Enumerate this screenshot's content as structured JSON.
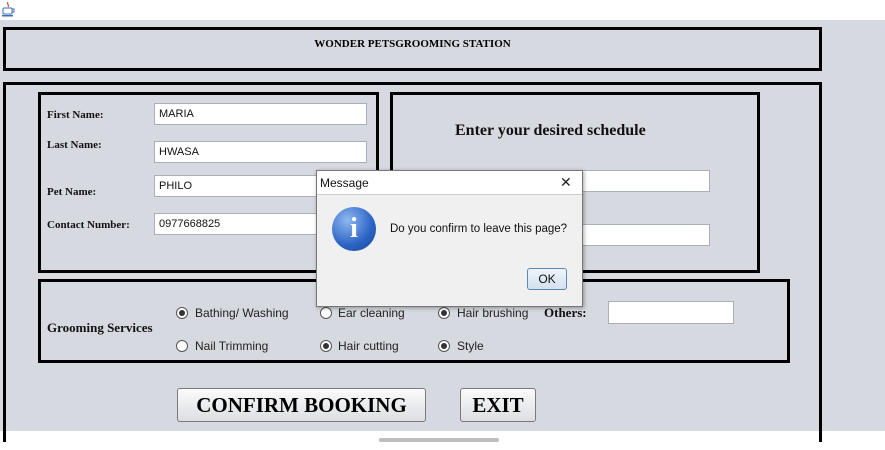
{
  "header": {
    "title": "WONDER PETSGROOMING STATION"
  },
  "form": {
    "first_name_label": "First Name:",
    "first_name_value": "MARIA",
    "last_name_label": "Last Name:",
    "last_name_value": "HWASA",
    "pet_name_label": "Pet Name:",
    "pet_name_value": "PHILO",
    "contact_label": "Contact Number:",
    "contact_value": "0977668825"
  },
  "schedule": {
    "title": "Enter your desired schedule"
  },
  "services": {
    "label": "Grooming Services",
    "options": [
      {
        "label": "Bathing/ Washing",
        "selected": true
      },
      {
        "label": "Ear cleaning",
        "selected": false
      },
      {
        "label": "Hair brushing",
        "selected": true
      },
      {
        "label": "Nail Trimming",
        "selected": false
      },
      {
        "label": "Hair cutting",
        "selected": true
      },
      {
        "label": "Style",
        "selected": true
      }
    ],
    "others_label": "Others:",
    "others_value": ""
  },
  "buttons": {
    "confirm": "CONFIRM BOOKING",
    "exit": "EXIT"
  },
  "dialog": {
    "title": "Message",
    "close_glyph": "✕",
    "info_glyph": "i",
    "message": "Do you confirm to leave this page?",
    "ok": "OK"
  },
  "colors": {
    "window_bg": "#d6d9df",
    "info_blue": "#2b63c4"
  }
}
